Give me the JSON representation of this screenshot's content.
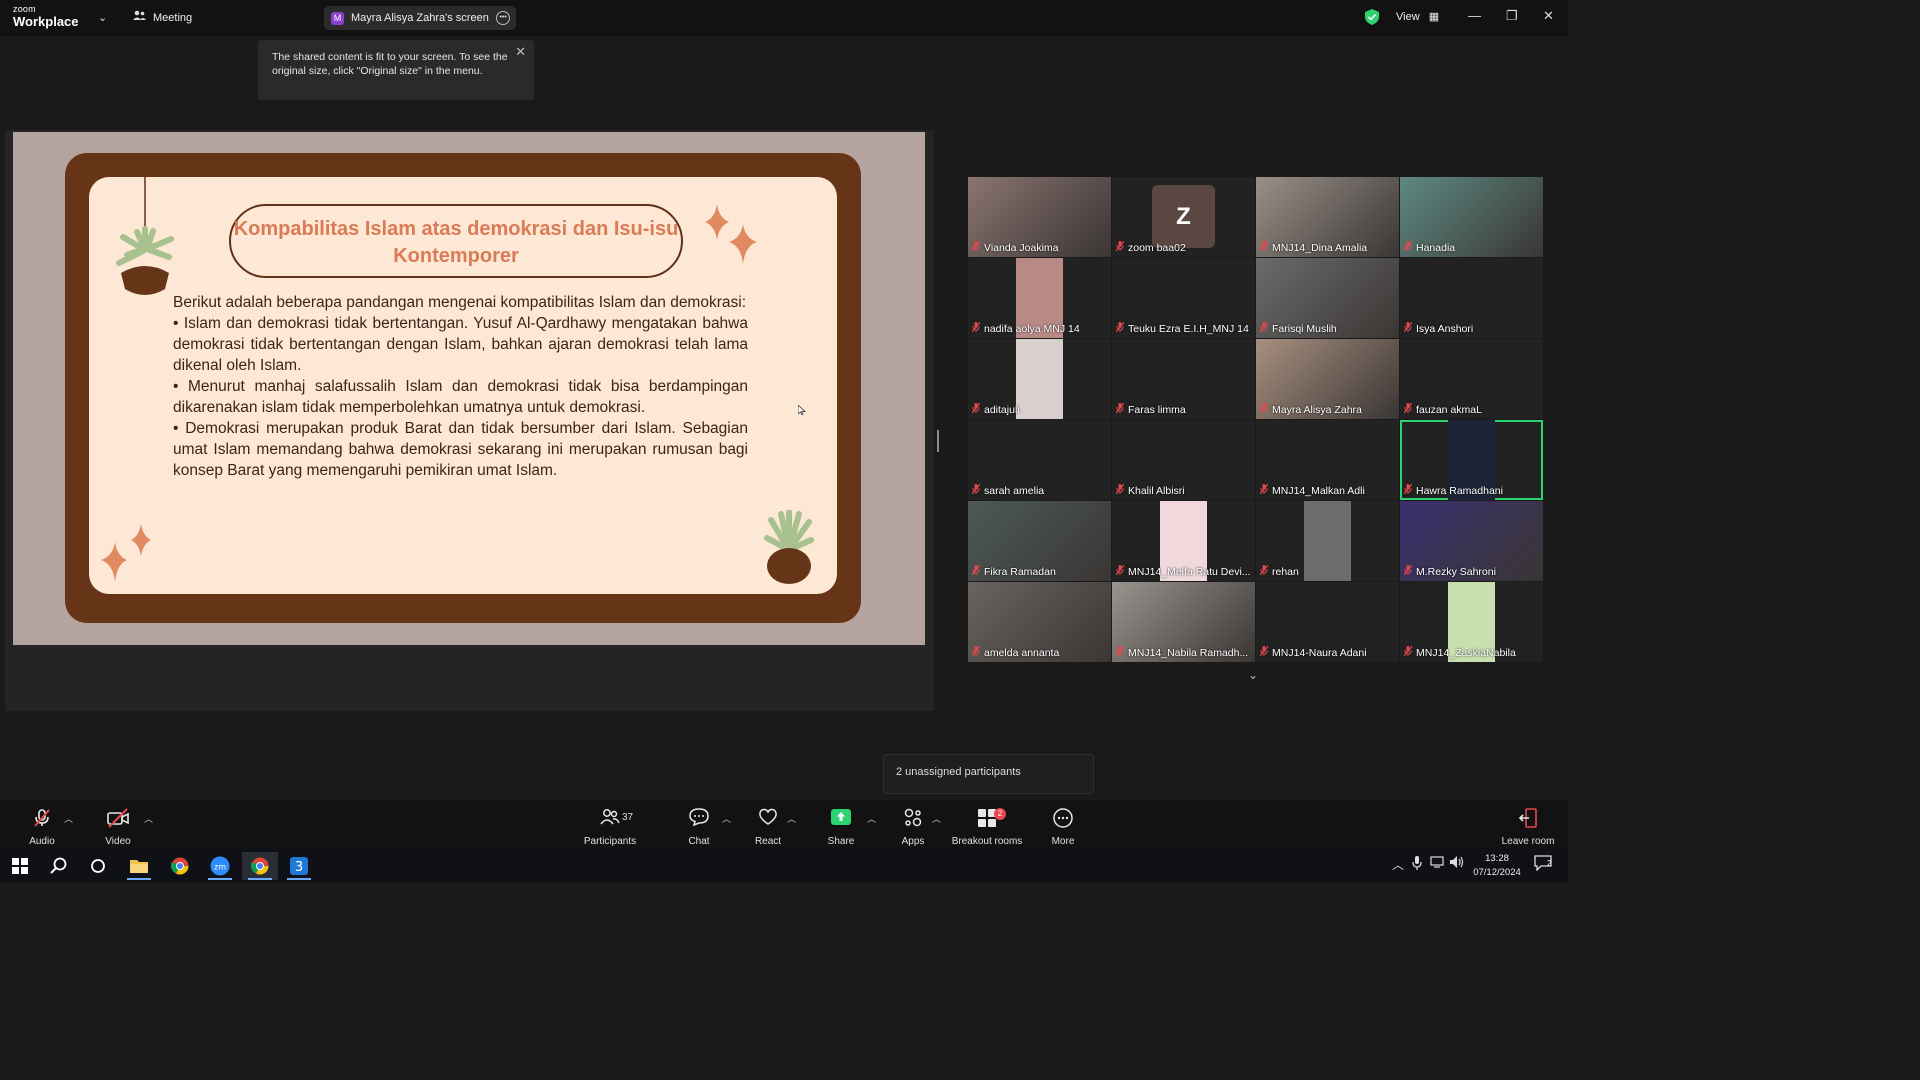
{
  "app": {
    "brand_small": "zoom",
    "brand_big": "Workplace",
    "meeting_label": "Meeting"
  },
  "share_pill": {
    "initial": "M",
    "label": "Mayra Alisya Zahra's screen"
  },
  "top_right": {
    "view_label": "View"
  },
  "tooltip": {
    "text": "The shared content is fit to your screen. To see the original size, click \"Original size\" in the menu."
  },
  "slide": {
    "title": "Kompabilitas Islam atas demokrasi dan Isu-isu Kontemporer",
    "body": "Berikut adalah beberapa pandangan mengenai kompatibilitas Islam dan demokrasi:\n• Islam dan demokrasi tidak bertentangan. Yusuf Al-Qardhawy mengatakan bahwa demokrasi tidak bertentangan dengan Islam, bahkan ajaran demokrasi telah lama dikenal oleh Islam.\n• Menurut manhaj salafussalih  Islam dan demokrasi tidak bisa berdampingan dikarenakan islam tidak memperbolehkan umatnya untuk demokrasi.\n• Demokrasi merupakan produk Barat dan tidak bersumber dari Islam. Sebagian umat Islam memandang bahwa demokrasi sekarang ini merupakan rumusan bagi konsep Barat yang memengaruhi pemikiran umat Islam."
  },
  "participants": [
    {
      "name": "Vianda Joakima",
      "bg": "#8a7470",
      "video": true
    },
    {
      "name": "zoom baa02",
      "bg": "#222222",
      "avatar": "Z"
    },
    {
      "name": "MNJ14_Dina Amalia",
      "bg": "#9a9088",
      "video": true
    },
    {
      "name": "Hanadia",
      "bg": "#5e8a82",
      "video": true
    },
    {
      "name": "nadifa aolya MNJ 14",
      "bg": "#222222",
      "inset": "#b88a86"
    },
    {
      "name": "Teuku Ezra E.I.H_MNJ 14",
      "bg": "#222222"
    },
    {
      "name": "Farisqi Muslih",
      "bg": "#6b6b6b",
      "video": true
    },
    {
      "name": "Isya Anshori",
      "bg": "#222222"
    },
    {
      "name": "aditajuli",
      "bg": "#222222",
      "inset": "#d8d0cc"
    },
    {
      "name": "Faras limma",
      "bg": "#222222"
    },
    {
      "name": "Mayra Alisya Zahra",
      "bg": "#a89080",
      "video": true
    },
    {
      "name": "fauzan akmaL",
      "bg": "#222222"
    },
    {
      "name": "sarah amelia",
      "bg": "#222222"
    },
    {
      "name": "Khalil Albisri",
      "bg": "#222222"
    },
    {
      "name": "MNJ14_Malkan Adli",
      "bg": "#222222"
    },
    {
      "name": "Hawra Ramadhani",
      "bg": "#222222",
      "inset": "#1c2438",
      "active": true
    },
    {
      "name": "Fikra Ramadan",
      "bg": "#4c5a58",
      "video": true
    },
    {
      "name": "MNJ14_Melfa Ratu Devi...",
      "bg": "#222222",
      "inset": "#f0d8dc"
    },
    {
      "name": "rehan",
      "bg": "#222222",
      "inset": "#6c6c6c"
    },
    {
      "name": "M.Rezky Sahroni",
      "bg": "#3a3070",
      "video": true
    },
    {
      "name": "amelda annanta",
      "bg": "#6a6460",
      "video": true
    },
    {
      "name": "MNJ14_Nabila Ramadh...",
      "bg": "#9a948e",
      "video": true
    },
    {
      "name": "MNJ14-Naura Adani",
      "bg": "#222222"
    },
    {
      "name": "MNJ14_ZaskiaNabila",
      "bg": "#222222",
      "inset": "#c8e0b0"
    }
  ],
  "unassigned": "2 unassigned participants",
  "toolbar": {
    "audio": "Audio",
    "video": "Video",
    "participants": "Participants",
    "participants_count": "37",
    "chat": "Chat",
    "react": "React",
    "share": "Share",
    "apps": "Apps",
    "breakout": "Breakout rooms",
    "breakout_badge": "2",
    "more": "More",
    "leave": "Leave room"
  },
  "taskbar": {
    "time": "13:28",
    "date": "07/12/2024",
    "notif_count": "2"
  },
  "colors": {
    "accent_green": "#2dd36f",
    "mic_muted": "#e5484d",
    "share_green": "#2dd36f",
    "title_orange": "#d97b56"
  }
}
